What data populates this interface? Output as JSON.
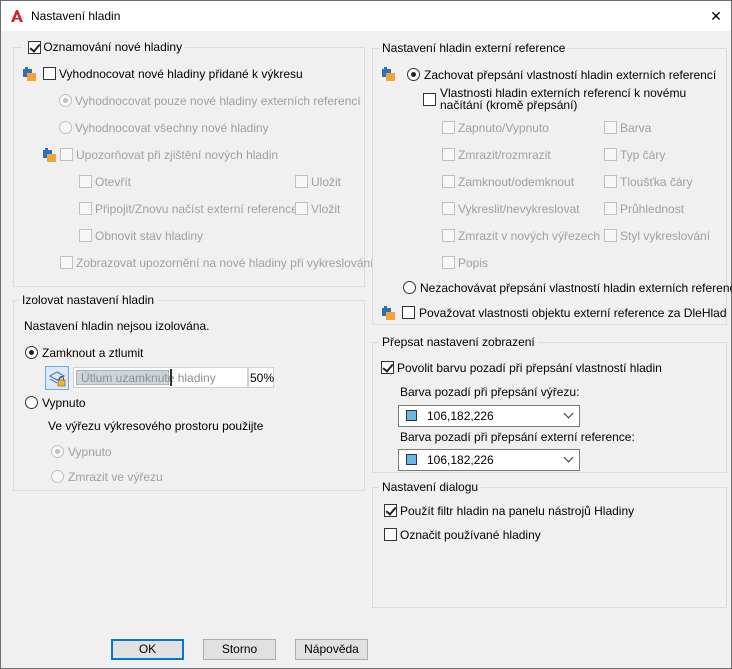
{
  "window": {
    "title": "Nastavení hladin",
    "close_glyph": "✕",
    "app_icon": "autocad-logo-icon"
  },
  "new_layers": {
    "title": "Oznamování nové hladiny",
    "checked": true,
    "evaluate_label": "Vyhodnocovat nové hladiny přidané k výkresu",
    "evaluate_checked": false,
    "xref_only_label": "Vyhodnocovat pouze nové hladiny externích referencí",
    "all_label": "Vyhodnocovat všechny nové hladiny",
    "notify_label": "Upozorňovat při zjištění nových hladin",
    "open_label": "Otevřít",
    "save_label": "Uložit",
    "attach_label": "Připojit/Znovu načíst externí reference",
    "insert_label": "Vložit",
    "restore_label": "Obnovit stav hladiny",
    "plot_warning_label": "Zobrazovat upozornění na nové hladiny při vykreslování"
  },
  "isolate": {
    "title": "Izolovat nastavení hladin",
    "status_text": "Nastavení hladin nejsou izolována.",
    "lock_fade_label": "Zamknout a ztlumit",
    "fade_field_label": "Útlum uzamknuté hladiny",
    "fade_value": "50%",
    "off_label": "Vypnuto",
    "viewport_text": "Ve výřezu výkresového prostoru použijte",
    "vp_off_label": "Vypnuto",
    "vp_freeze_label": "Zmrazit ve výřezu"
  },
  "xref": {
    "title": "Nastavení hladin externí reference",
    "keep_label": "Zachovat přepsání vlastností hladin externích referencí",
    "reload_label_line1": "Vlastnosti hladin externích referencí k novému",
    "reload_label_line2": "načítání (kromě přepsání)",
    "props_left": [
      "Zapnuto/Vypnuto",
      "Zmrazit/rozmrazit",
      "Zamknout/odemknout",
      "Vykreslit/nevykreslovat",
      "Zmrazit v nových výřezech",
      "Popis"
    ],
    "props_right": [
      "Barva",
      "Typ čáry",
      "Tloušťka čáry",
      "Průhlednost",
      "Styl vykreslování"
    ],
    "discard_label": "Nezachovávat přepsání vlastností hladin externích referencí",
    "bylayer_label": "Považovat vlastnosti objektu externí reference za DleHlad"
  },
  "override": {
    "title": "Přepsat nastavení zobrazení",
    "enable_bg_label": "Povolit barvu pozadí při přepsání vlastností hladin",
    "vp_bg_label": "Barva pozadí při přepsání výřezu:",
    "vp_color_value": "106,182,226",
    "xref_bg_label": "Barva pozadí při přepsání externí reference:",
    "xref_color_value": "106,182,226",
    "color_hex": "#6ab6e2"
  },
  "dialog_settings": {
    "title": "Nastavení dialogu",
    "filter_label": "Použít filtr hladin na panelu nástrojů Hladiny",
    "mark_used_label": "Označit používané hladiny"
  },
  "buttons": {
    "ok": "OK",
    "cancel": "Storno",
    "help": "Nápověda"
  }
}
